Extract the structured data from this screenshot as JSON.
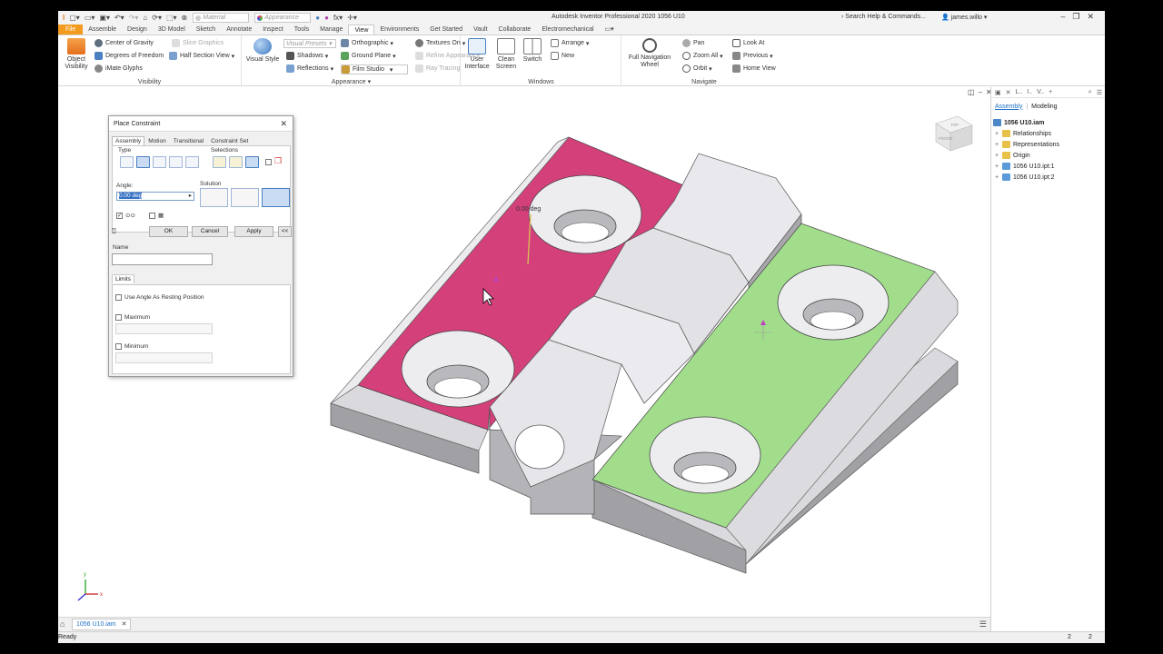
{
  "window": {
    "title": "Autodesk Inventor Professional 2020   1056 U10",
    "search_placeholder": "Search Help & Commands...",
    "user": "james.willo",
    "qat_material": "Material",
    "qat_appearance": "Appearance"
  },
  "tabs": [
    "File",
    "Assemble",
    "Design",
    "3D Model",
    "Sketch",
    "Annotate",
    "Inspect",
    "Tools",
    "Manage",
    "View",
    "Environments",
    "Get Started",
    "Vault",
    "Collaborate",
    "Electromechanical"
  ],
  "active_tab": "View",
  "ribbon": {
    "visibility": {
      "title": "Visibility",
      "object_visibility": "Object\nVisibility",
      "center_gravity": "Center of Gravity",
      "slice_graphics": "Slice Graphics",
      "degrees_freedom": "Degrees of Freedom",
      "half_section": "Half Section View",
      "imate_glyphs": "iMate Glyphs"
    },
    "appearance": {
      "title": "Appearance",
      "visual_style": "Visual Style",
      "visual_presets": "Visual Presets",
      "orthographic": "Orthographic",
      "textures": "Textures On",
      "shadows": "Shadows",
      "ground_plane": "Ground Plane",
      "refine": "Refine Appearance",
      "reflections": "Reflections",
      "film_studio": "Film Studio",
      "ray_tracing": "Ray Tracing"
    },
    "windows": {
      "title": "Windows",
      "user_interface": "User\nInterface",
      "clean_screen": "Clean\nScreen",
      "switch": "Switch",
      "arrange": "Arrange",
      "new": "New"
    },
    "navigate": {
      "title": "Navigate",
      "full_nav": "Full Navigation\nWheel",
      "pan": "Pan",
      "zoom_all": "Zoom All",
      "orbit": "Orbit",
      "look_at": "Look At",
      "previous": "Previous",
      "home_view": "Home View"
    }
  },
  "dialog": {
    "title": "Place Constraint",
    "tabs": [
      "Assembly",
      "Motion",
      "Transitional",
      "Constraint Set"
    ],
    "type_label": "Type",
    "selections_label": "Selections",
    "angle_label": "Angle:",
    "angle_value": "0.00 deg",
    "solution_label": "Solution",
    "ok": "OK",
    "cancel": "Cancel",
    "apply": "Apply",
    "more": "<<",
    "name_label": "Name",
    "limits_tab": "Limits",
    "use_angle": "Use Angle As Resting Position",
    "maximum": "Maximum",
    "minimum": "Minimum"
  },
  "viewport": {
    "angle_annotation": "0.00 deg",
    "viewcube_top": "TOP",
    "viewcube_front": "FRONT",
    "colors": {
      "pink": "#d4407a",
      "green": "#a2dd8c",
      "grey": "#e6e6ea",
      "side": "#9b9b9f"
    }
  },
  "browser": {
    "tab_assembly": "Assembly",
    "tab_modeling": "Modeling",
    "root": "1056 U10.iam",
    "items": [
      "Relationships",
      "Representations",
      "Origin",
      "1056 U10.ipt:1",
      "1056 U10.ipt:2"
    ]
  },
  "doc_tab": "1056 U10.iam",
  "status": {
    "text": "Ready",
    "n1": "2",
    "n2": "2"
  }
}
